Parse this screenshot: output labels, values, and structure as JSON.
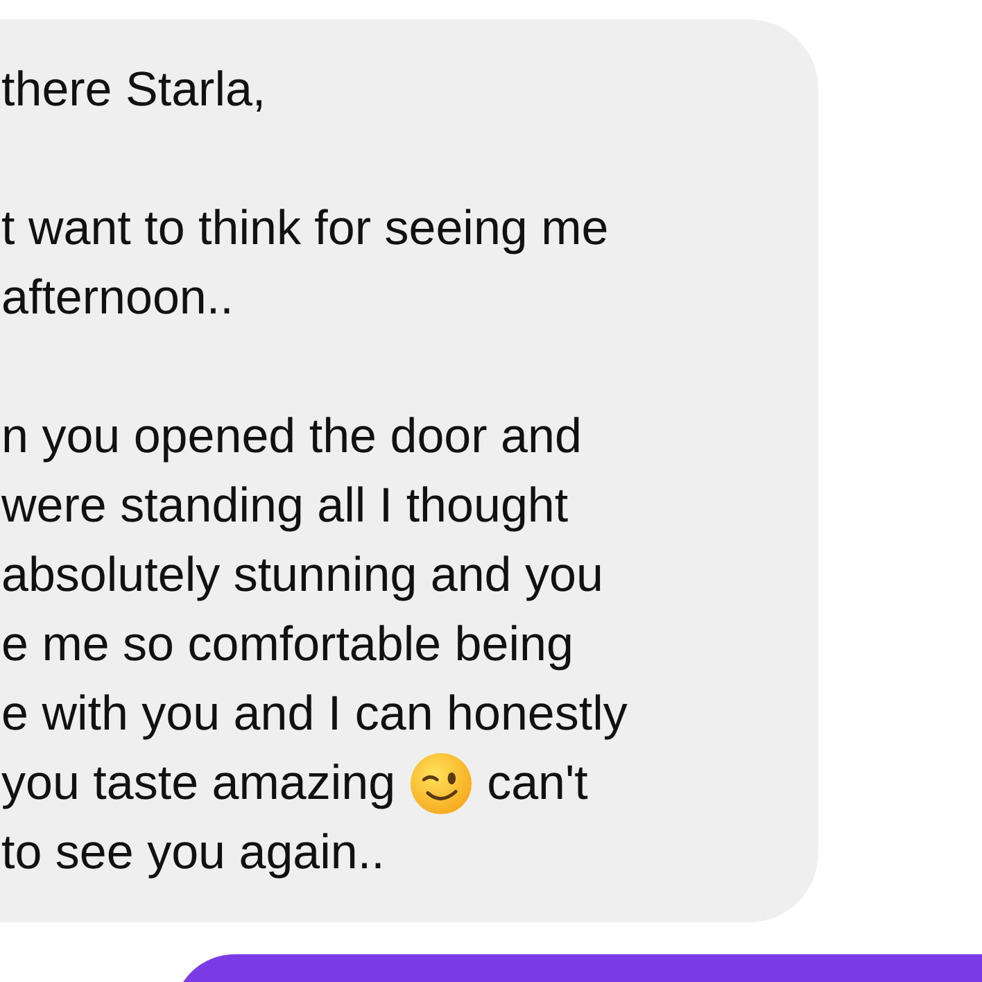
{
  "received_message": {
    "lines": [
      {
        "kind": "text",
        "text": "there Starla,"
      },
      {
        "kind": "blank"
      },
      {
        "kind": "text",
        "text": "t want to think for seeing me"
      },
      {
        "kind": "text",
        "text": "afternoon.."
      },
      {
        "kind": "blank"
      },
      {
        "kind": "text",
        "text": "n you opened the door and"
      },
      {
        "kind": "text",
        "text": "were standing all I thought"
      },
      {
        "kind": "text",
        "text": "absolutely stunning and you"
      },
      {
        "kind": "text",
        "text": "e me so comfortable being"
      },
      {
        "kind": "text",
        "text": "e with you and I can honestly"
      },
      {
        "kind": "emoji",
        "before": "you taste amazing",
        "after": "can't"
      },
      {
        "kind": "text",
        "text": "to see you again.."
      }
    ]
  },
  "sent_message": {
    "kind": "bubble"
  }
}
